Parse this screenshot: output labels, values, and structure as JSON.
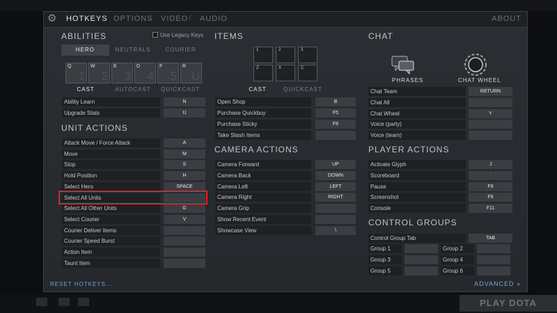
{
  "nav": {
    "tabs": [
      "HOTKEYS",
      "OPTIONS",
      "VIDEO",
      "AUDIO"
    ],
    "separator": "/",
    "about": "ABOUT"
  },
  "abilities": {
    "title": "ABILITIES",
    "legacy_label": "Use Legacy Keys",
    "legacy_checked": false,
    "tabs": [
      "HERO",
      "NEUTRALS",
      "COURIER"
    ],
    "slots": [
      {
        "key": "Q",
        "num": "1"
      },
      {
        "key": "W",
        "num": "2"
      },
      {
        "key": "E",
        "num": "3"
      },
      {
        "key": "D",
        "num": "4"
      },
      {
        "key": "F",
        "num": "5"
      },
      {
        "key": "R",
        "num": "U"
      }
    ],
    "modes": [
      "CAST",
      "AUTOCAST",
      "QUICKCAST"
    ],
    "rows": [
      {
        "label": "Ability Learn",
        "key": "N"
      },
      {
        "label": "Upgrade Stats",
        "key": "U"
      }
    ]
  },
  "unit_actions": {
    "title": "UNIT ACTIONS",
    "rows": [
      {
        "label": "Attack Move / Force Attack",
        "key": "A"
      },
      {
        "label": "Move",
        "key": "M"
      },
      {
        "label": "Stop",
        "key": "S"
      },
      {
        "label": "Hold Position",
        "key": "H"
      },
      {
        "label": "Select Hero",
        "key": "SPACE"
      },
      {
        "label": "Select All Units",
        "key": ""
      },
      {
        "label": "Select All Other Units",
        "key": "G"
      },
      {
        "label": "Select Courier",
        "key": "V"
      },
      {
        "label": "Courier Deliver Items",
        "key": ""
      },
      {
        "label": "Courier Speed Burst",
        "key": ""
      },
      {
        "label": "Action Item",
        "key": ""
      },
      {
        "label": "Taunt Item",
        "key": ""
      }
    ]
  },
  "items": {
    "title": "ITEMS",
    "slots": [
      "1",
      "2",
      "3",
      "Z",
      "X",
      "C"
    ],
    "modes": [
      "CAST",
      "QUICKCAST"
    ],
    "rows": [
      {
        "label": "Open Shop",
        "key": "B"
      },
      {
        "label": "Purchase Quickbuy",
        "key": "F5"
      },
      {
        "label": "Purchase Sticky",
        "key": "F8"
      },
      {
        "label": "Take Stash Items",
        "key": ""
      }
    ]
  },
  "camera_actions": {
    "title": "CAMERA ACTIONS",
    "rows": [
      {
        "label": "Camera Forward",
        "key": "UP"
      },
      {
        "label": "Camera Back",
        "key": "DOWN"
      },
      {
        "label": "Camera Left",
        "key": "LEFT"
      },
      {
        "label": "Camera Right",
        "key": "RIGHT"
      },
      {
        "label": "Camera Grip",
        "key": ""
      },
      {
        "label": "Show Recent Event",
        "key": ""
      },
      {
        "label": "Showcase View",
        "key": "\\"
      }
    ]
  },
  "chat": {
    "title": "CHAT",
    "phrases_label": "PHRASES",
    "wheel_label": "CHAT WHEEL",
    "rows": [
      {
        "label": "Chat Team",
        "key": "RETURN"
      },
      {
        "label": "Chat All",
        "key": ""
      },
      {
        "label": "Chat Wheel",
        "key": "Y"
      },
      {
        "label": "Voice (party)",
        "key": ""
      },
      {
        "label": "Voice (team)",
        "key": ""
      }
    ]
  },
  "player_actions": {
    "title": "PLAYER ACTIONS",
    "rows": [
      {
        "label": "Activate Glyph",
        "key": "J"
      },
      {
        "label": "Scoreboard",
        "key": "`"
      },
      {
        "label": "Pause",
        "key": "F9"
      },
      {
        "label": "Screenshot",
        "key": "F6"
      },
      {
        "label": "Console",
        "key": "F11"
      }
    ]
  },
  "control_groups": {
    "title": "CONTROL GROUPS",
    "tab_row": {
      "label": "Control Group Tab",
      "key": "TAB"
    },
    "groups": [
      "Group 1",
      "Group 2",
      "Group 3",
      "Group 4",
      "Group 5",
      "Group 6"
    ]
  },
  "footer": {
    "reset": "RESET HOTKEYS...",
    "advanced": "ADVANCED »"
  },
  "play_button": "PLAY DOTA",
  "colors": {
    "accent": "#6aa6dc",
    "highlight": "#d8262a"
  }
}
